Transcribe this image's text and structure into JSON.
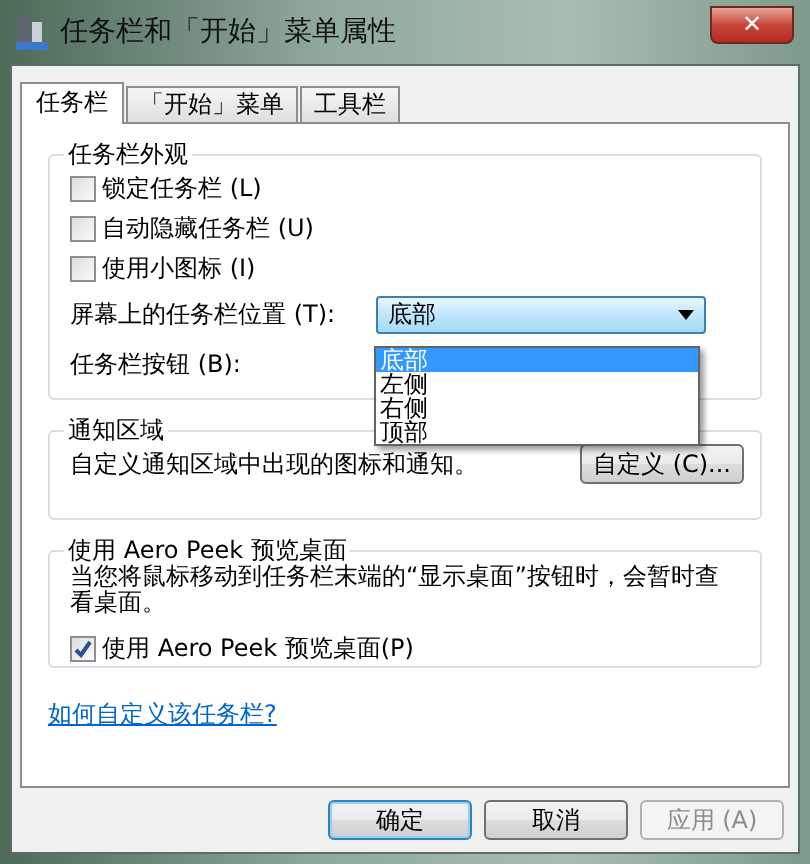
{
  "window": {
    "title": "任务栏和「开始」菜单属性",
    "close": "✕"
  },
  "tabs": [
    {
      "label": "任务栏",
      "selected": true
    },
    {
      "label": "「开始」菜单",
      "selected": false
    },
    {
      "label": "工具栏",
      "selected": false
    }
  ],
  "appearance": {
    "title": "任务栏外观",
    "checkboxes": [
      {
        "label": "锁定任务栏 (L)",
        "checked": false
      },
      {
        "label": "自动隐藏任务栏 (U)",
        "checked": false
      },
      {
        "label": "使用小图标 (I)",
        "checked": false
      }
    ],
    "position": {
      "label": "屏幕上的任务栏位置 (T):",
      "value": "底部",
      "expanded": true,
      "options": [
        {
          "label": "底部",
          "selected": true
        },
        {
          "label": "左侧",
          "selected": false
        },
        {
          "label": "右侧",
          "selected": false
        },
        {
          "label": "顶部",
          "selected": false
        }
      ]
    },
    "buttons_label": "任务栏按钮 (B):"
  },
  "notification": {
    "title": "通知区域",
    "text": "自定义通知区域中出现的图标和通知。",
    "button": "自定义 (C)..."
  },
  "peek": {
    "title": "使用 Aero Peek 预览桌面",
    "text": "当您将鼠标移动到任务栏末端的“显示桌面”按钮时，会暂时查看桌面。",
    "checkbox": {
      "label": "使用 Aero Peek 预览桌面(P)",
      "checked": true
    }
  },
  "help_link": "如何自定义该任务栏?",
  "buttons": [
    {
      "label": "确定",
      "default": true,
      "disabled": false
    },
    {
      "label": "取消",
      "default": false,
      "disabled": false
    },
    {
      "label": "应用 (A)",
      "default": false,
      "disabled": true
    }
  ]
}
